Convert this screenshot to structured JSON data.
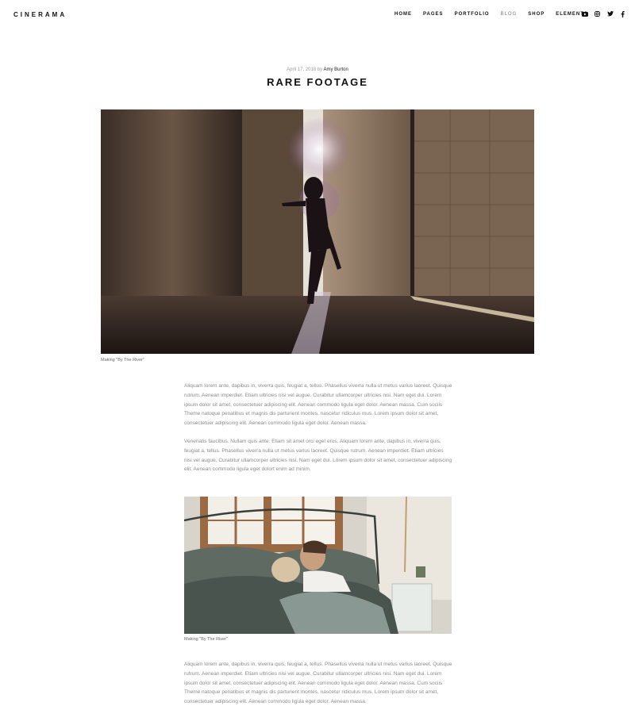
{
  "header": {
    "logo": "CINERAMA",
    "nav": [
      {
        "label": "HOME",
        "active": false
      },
      {
        "label": "PAGES",
        "active": false
      },
      {
        "label": "PORTFOLIO",
        "active": false
      },
      {
        "label": "BLOG",
        "active": true
      },
      {
        "label": "SHOP",
        "active": false
      },
      {
        "label": "ELEMENTS",
        "active": false
      }
    ],
    "social": [
      "youtube-icon",
      "instagram-icon",
      "twitter-icon",
      "facebook-icon"
    ]
  },
  "post": {
    "date": "April 17, 2018",
    "by": "by",
    "author": "Amy Burton",
    "title": "RARE FOOTAGE",
    "image1_caption": "Making \"By The River\"",
    "paragraph1": "Aliquam lorem ante, dapibus in, viverra quis, feugiat a, tellus. Phasellus viverra nulla ut metus varius laoreet. Quisque rutrum. Aenean imperdiet. Etiam ultricies nisi vel augue. Curabitur ullamcorper ultricies nisi. Nam eget dui. Lorem ipsum dolor sit amet, consectetuer adipiscing elit. Aenean commodo ligula eget dolor. Aenean massa. Cum sociis Theme natoque penatibus et magnis dis parturient montes, nascetur ridiculus mus. Lorem ipsum dolor sit amet, consectetuer adipiscing elit. Aenean commodo ligula eget dolor. Aenean massa.",
    "paragraph2": "Venenatis faucibus. Nullam quis ante. Etiam sit amet orci eget eros. Aliquam lorem ante, dapibus in, viverra quis, feugiat a, tellus. Phasellus viverra nulla ut metus varius laoreet. Quisque rutrum. Aenean imperdiet. Etiam ultricies nisi vel augue. Curabitur ullamcorper ultricies nisi. Nam eget dui. Lorem ipsum dolor sit amet, consectetuer adipiscing elit. Aenean commodo ligula eget dolort enim ad minim.",
    "image2_caption": "Making \"By The River\"",
    "paragraph3": "Aliquam lorem ante, dapibus in, viverra quis, feugiat a, tellus. Phasellus viverra nulla ut metus varius laoreet. Quisque rutrum. Aenean imperdiet. Etiam ultricies nisi vel augue. Curabitur ullamcorper ultricies nisi. Nam eget dui. Lorem ipsum dolor sit amet, consectetuer adipiscing elit. Aenean commodo ligula eget dolor. Aenean massa. Cum sociis Theme natoque penatibus et magnis dis parturient montes, nascetur ridiculus mus. Lorem ipsum dolor sit amet, consectetuer adipiscing elit. Aenean commodo ligula eget dolor. Aenean massa."
  }
}
